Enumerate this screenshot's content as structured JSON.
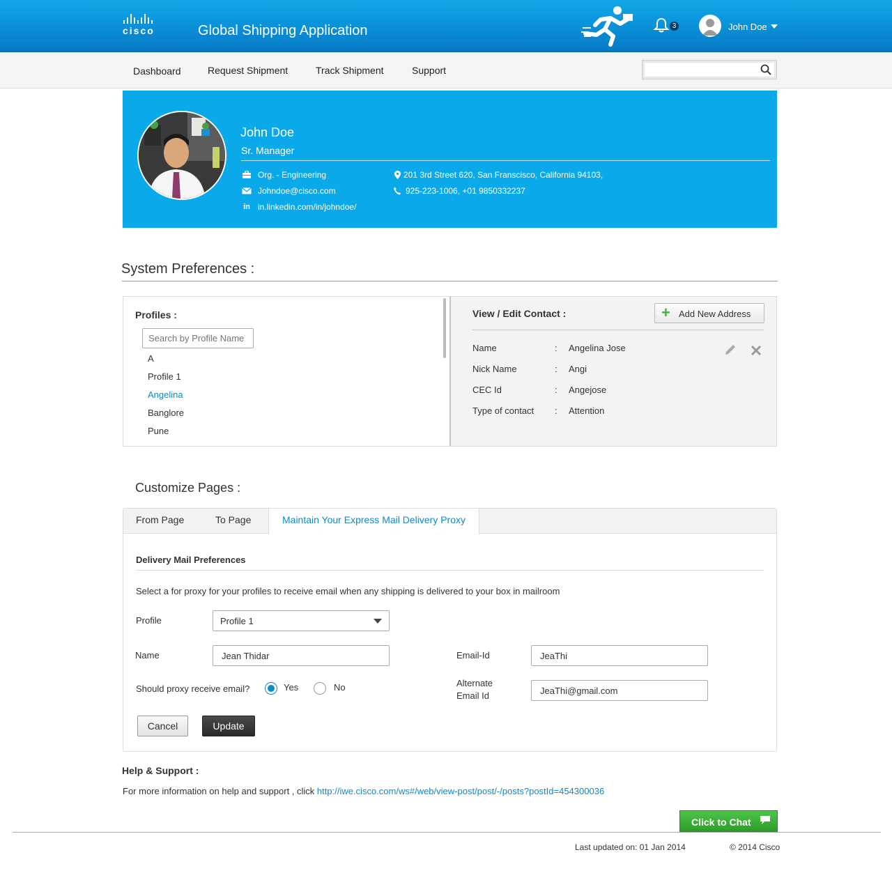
{
  "header": {
    "logo_text": "cisco",
    "app_title": "Global Shipping Application",
    "notifications_count": "3",
    "user_name": "John Doe"
  },
  "nav": {
    "items": [
      "Dashboard",
      "Request Shipment",
      "Track Shipment",
      "Support"
    ],
    "search_value": ""
  },
  "profile": {
    "name": "John Doe",
    "title": "Sr. Manager",
    "org": "Org. - Engineering",
    "email": "Johndoe@cisco.com",
    "linkedin": "in.linkedin.com/in/johndoe/",
    "linkedin_icon_text": "in",
    "address": "201 3rd Street 620, San Franscisco, California 94103,",
    "phone": "925-223-1006, +01 9850332237"
  },
  "system_prefs": {
    "title": "System Preferences :",
    "profiles_label": "Profiles :",
    "search_placeholder": "Search by Profile Name",
    "profiles": [
      "A",
      "Profile 1",
      "Angelina",
      "Banglore",
      "Pune"
    ],
    "active_profile": "Angelina",
    "contact_label": "View / Edit Contact :",
    "add_address_label": "Add New Address",
    "contact_fields": [
      {
        "label": "Name",
        "value": "Angelina Jose"
      },
      {
        "label": "Nick Name",
        "value": "Angi"
      },
      {
        "label": "CEC Id",
        "value": "Angejose"
      },
      {
        "label": "Type of contact",
        "value": "Attention"
      }
    ],
    "colon": ":"
  },
  "customize": {
    "title": "Customize Pages :",
    "tabs": [
      "From Page",
      "To Page",
      "Maintain Your Express Mail Delivery Proxy"
    ],
    "active_tab": "Maintain Your Express Mail Delivery Proxy",
    "form_title": "Delivery Mail Preferences",
    "form_desc": "Select a for proxy for your profiles to receive email when any shipping is delivered to your box in mailroom",
    "profile_label": "Profile",
    "profile_value": "Profile 1",
    "name_label": "Name",
    "name_value": "Jean Thidar",
    "email_label": "Email-Id",
    "email_value": "JeaThi",
    "proxy_question": "Should proxy receive email?",
    "proxy_yes": "Yes",
    "proxy_no": "No",
    "proxy_selected": "Yes",
    "alt_email_label_1": "Alternate",
    "alt_email_label_2": "Email Id",
    "alt_email_value": "JeaThi@gmail.com",
    "cancel_label": "Cancel",
    "update_label": "Update"
  },
  "help": {
    "title": "Help & Support :",
    "text": "For more information on help and support , click ",
    "link": "http://iwe.cisco.com/ws#/web/view-post/post/-/posts?postId=454300036"
  },
  "chat": {
    "label": "Click to Chat"
  },
  "footer": {
    "last_updated": "Last updated on: 01 Jan 2014",
    "copyright": "© 2014 Cisco"
  },
  "colors": {
    "header_blue": "#0a8fd6",
    "card_blue": "#0aa9ea",
    "link_blue": "#1089c9",
    "chat_green": "#3db43a"
  }
}
